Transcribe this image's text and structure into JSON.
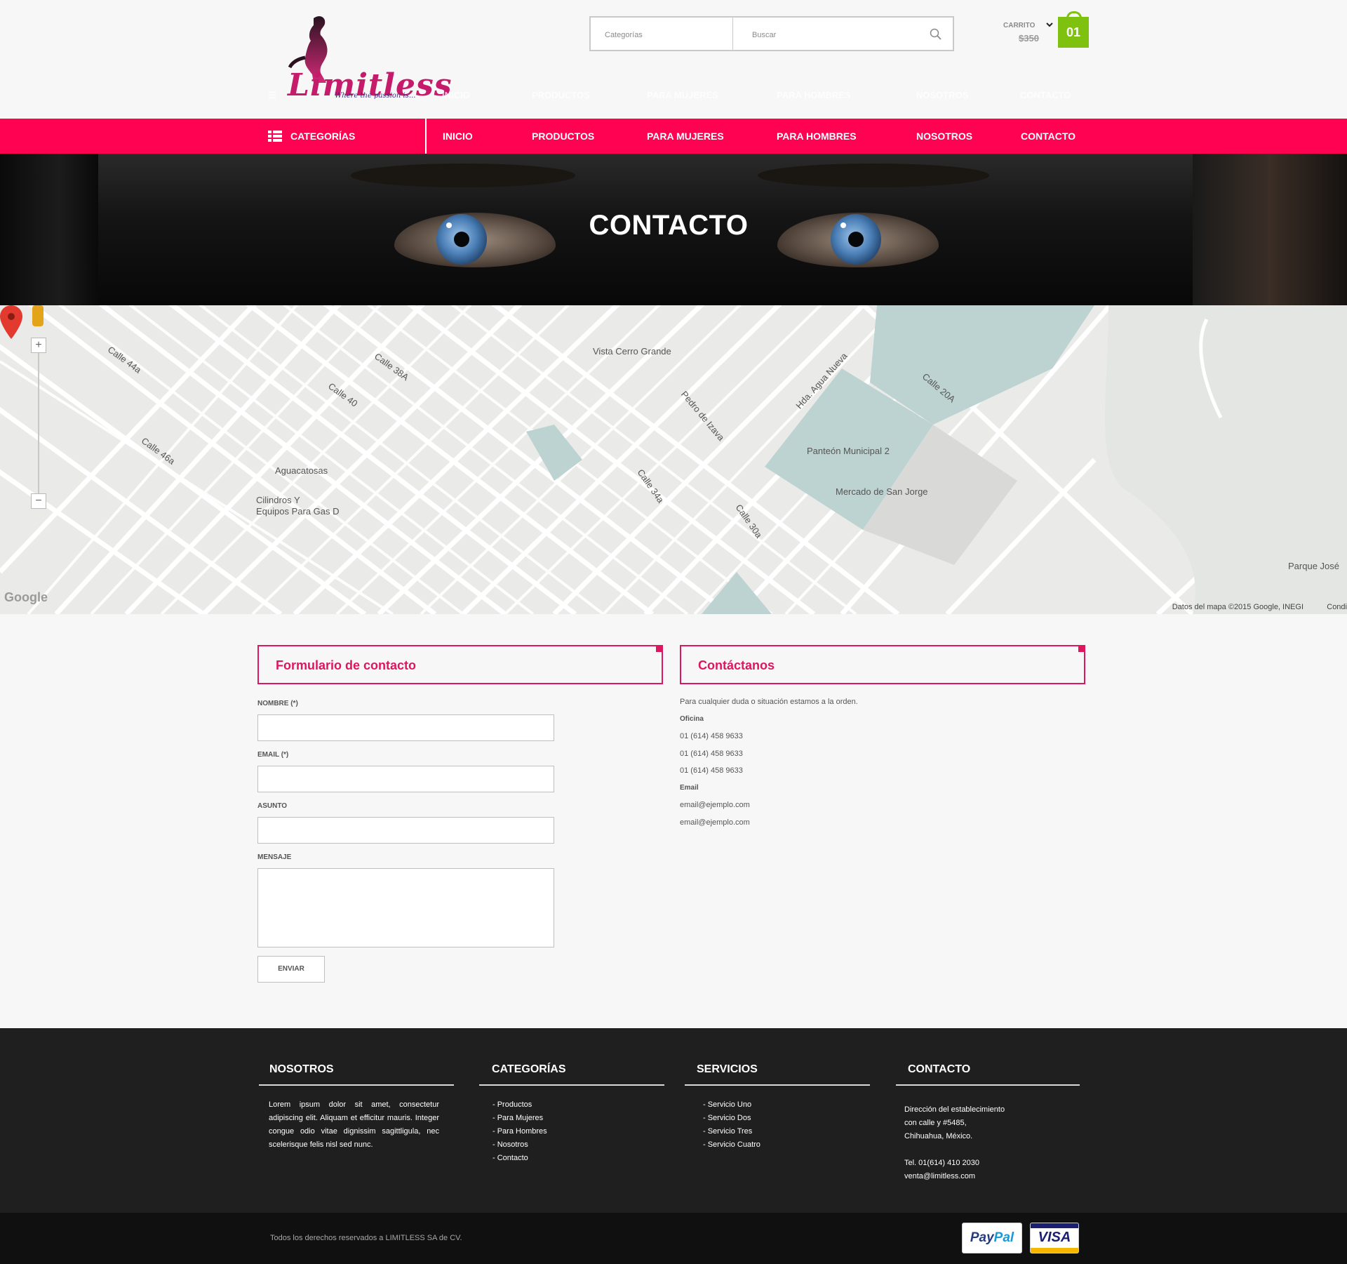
{
  "brand": {
    "name": "Limitless",
    "tagline": "Where the passion is..."
  },
  "search": {
    "category_placeholder": "Categorías",
    "query_placeholder": "Buscar"
  },
  "cart": {
    "label": "CARRITO",
    "total": "$350",
    "count": "01"
  },
  "nav": {
    "categories_label": "CATEGORÍAS",
    "links": [
      "INICIO",
      "PRODUCTOS",
      "PARA MUJERES",
      "PARA HOMBRES",
      "NOSOTROS",
      "CONTACTO"
    ]
  },
  "hero": {
    "title": "CONTACTO"
  },
  "map": {
    "credit": "Datos del mapa ©2015 Google, INEGI",
    "terms": "Condi",
    "google": "Google",
    "labels": [
      "Vista Cerro Grande",
      "Panteón Municipal 2",
      "Mercado de San Jorge",
      "Aguacatosas",
      "Cilindros Y",
      "Equipos Para Gas D",
      "Calle 38A",
      "Calle 46a",
      "Calle 20A",
      "Calle 44a",
      "Calle 40",
      "Pedro de Izava",
      "Hda. Agua Nueva",
      "Parque José",
      "Calle 30a",
      "Calle 34a"
    ],
    "zoom_in": "+",
    "zoom_out": "−"
  },
  "form": {
    "title": "Formulario de contacto",
    "name_label": "NOMBRE (*)",
    "email_label": "EMAIL (*)",
    "subject_label": "ASUNTO",
    "message_label": "MENSAJE",
    "submit": "ENVIAR"
  },
  "contact_panel": {
    "title": "Contáctanos",
    "intro": "Para cualquier duda o situación estamos a la orden.",
    "office_label": "Oficina",
    "phones": [
      "01 (614) 458 9633",
      "01 (614) 458 9633",
      "01 (614) 458 9633"
    ],
    "email_label": "Email",
    "emails": [
      "email@ejemplo.com",
      "email@ejemplo.com"
    ]
  },
  "footer": {
    "about": {
      "title": "NOSOTROS",
      "text": "Lorem ipsum dolor sit amet, consectetur adipiscing elit. Aliquam et efficitur mauris. Integer congue odio vitae dignissim sagittligula, nec scelerisque felis nisl sed nunc."
    },
    "categories": {
      "title": "CATEGORÍAS",
      "items": [
        "- Productos",
        "- Para Mujeres",
        "- Para Hombres",
        "- Nosotros",
        "- Contacto"
      ]
    },
    "services": {
      "title": "SERVICIOS",
      "items": [
        "- Servicio  Uno",
        "- Servicio Dos",
        "- Servicio Tres",
        "- Servicio Cuatro"
      ]
    },
    "contact": {
      "title": "CONTACTO",
      "address": [
        "Dirección del establecimiento",
        "con calle  y #5485,",
        "Chihuahua, México."
      ],
      "phone": "Tel. 01(614) 410 2030",
      "email": "venta@limitless.com"
    }
  },
  "bottom": {
    "copyright": "Todos los derechos reservados a LIMITLESS SA de CV.",
    "paypal_a": "Pay",
    "paypal_b": "Pal",
    "visa": "VISA"
  },
  "colors": {
    "accent": "#ff0252",
    "accent_dark": "#dc1760",
    "cart_green": "#7ec20f",
    "footer_bg": "#1f1f1f"
  }
}
